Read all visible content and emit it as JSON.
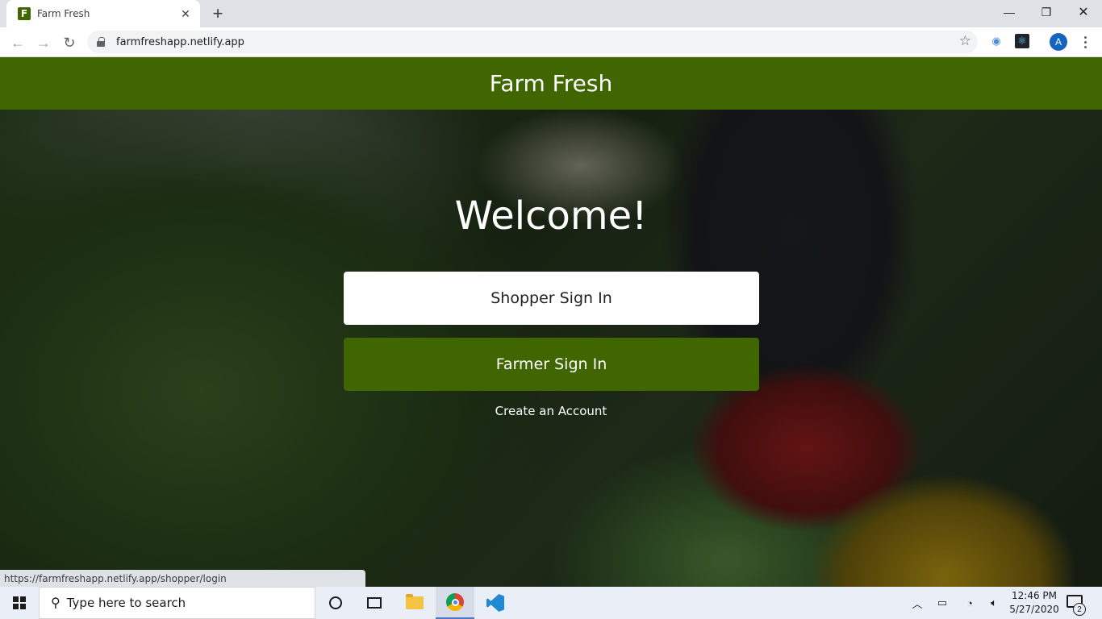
{
  "browser": {
    "tab_title": "Farm Fresh",
    "favicon_letter": "F",
    "url": "farmfreshapp.netlify.app",
    "avatar_initial": "A",
    "status_url": "https://farmfreshapp.netlify.app/shopper/login"
  },
  "site": {
    "header_title": "Farm Fresh",
    "welcome": "Welcome!",
    "shopper_button": "Shopper Sign In",
    "farmer_button": "Farmer Sign In",
    "create_account": "Create an Account",
    "brand_color": "#3f6600"
  },
  "taskbar": {
    "search_placeholder": "Type here to search",
    "time": "12:46 PM",
    "date": "5/27/2020",
    "notification_count": "2"
  }
}
